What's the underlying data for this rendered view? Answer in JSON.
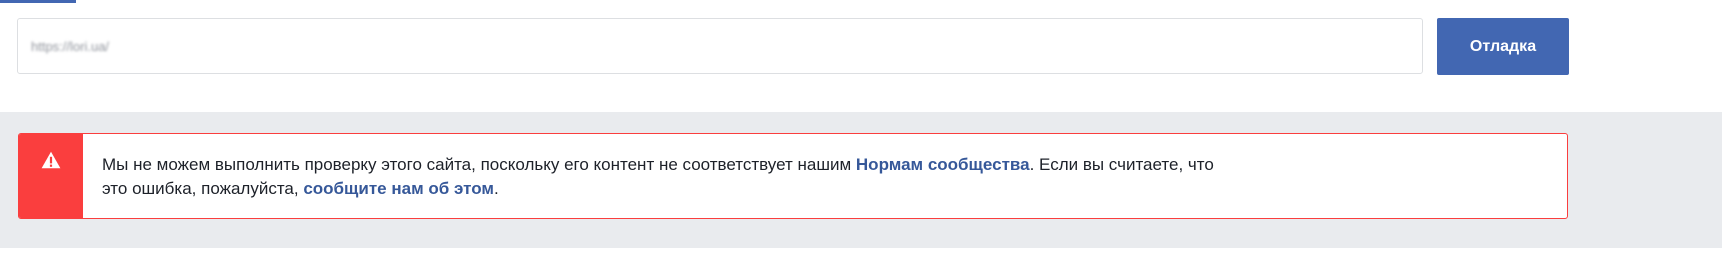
{
  "url_bar": {
    "value": "https://lori.ua/"
  },
  "debug_button": {
    "label": "Отладка"
  },
  "alert": {
    "text_part1": "Мы не можем выполнить проверку этого сайта, поскольку его контент не соответствует нашим ",
    "link1_label": "Нормам сообщества",
    "text_part2": ". Если вы считаете, что",
    "text_part3": "это ошибка, пожалуйста, ",
    "link2_label": "сообщите нам об этом",
    "text_part4": ".",
    "icon": "warning-icon"
  },
  "colors": {
    "accent": "#4267b2",
    "alert_red": "#fa3e3e",
    "link": "#365899",
    "background_band": "#e9ebee"
  }
}
